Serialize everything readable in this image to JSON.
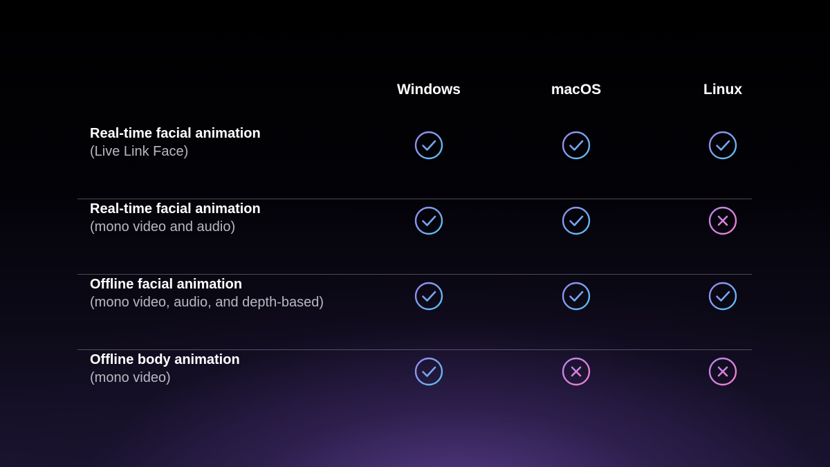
{
  "columns": [
    "Windows",
    "macOS",
    "Linux"
  ],
  "rows": [
    {
      "title": "Real-time facial animation",
      "subtitle": "(Live Link Face)",
      "support": [
        "yes",
        "yes",
        "yes"
      ]
    },
    {
      "title": "Real-time facial animation",
      "subtitle": "(mono video and audio)",
      "support": [
        "yes",
        "yes",
        "no"
      ]
    },
    {
      "title": "Offline facial animation",
      "subtitle": "(mono video, audio, and depth-based)",
      "support": [
        "yes",
        "yes",
        "yes"
      ]
    },
    {
      "title": "Offline body animation",
      "subtitle": "(mono video)",
      "support": [
        "yes",
        "no",
        "no"
      ]
    }
  ],
  "icons": {
    "yes": "check-circle-icon",
    "no": "x-circle-icon"
  },
  "colors": {
    "check_gradient": [
      "#9a86f0",
      "#58c2f2"
    ],
    "cross_gradient": [
      "#b784ec",
      "#f07fd0"
    ],
    "divider": "rgba(255,255,255,0.28)"
  }
}
